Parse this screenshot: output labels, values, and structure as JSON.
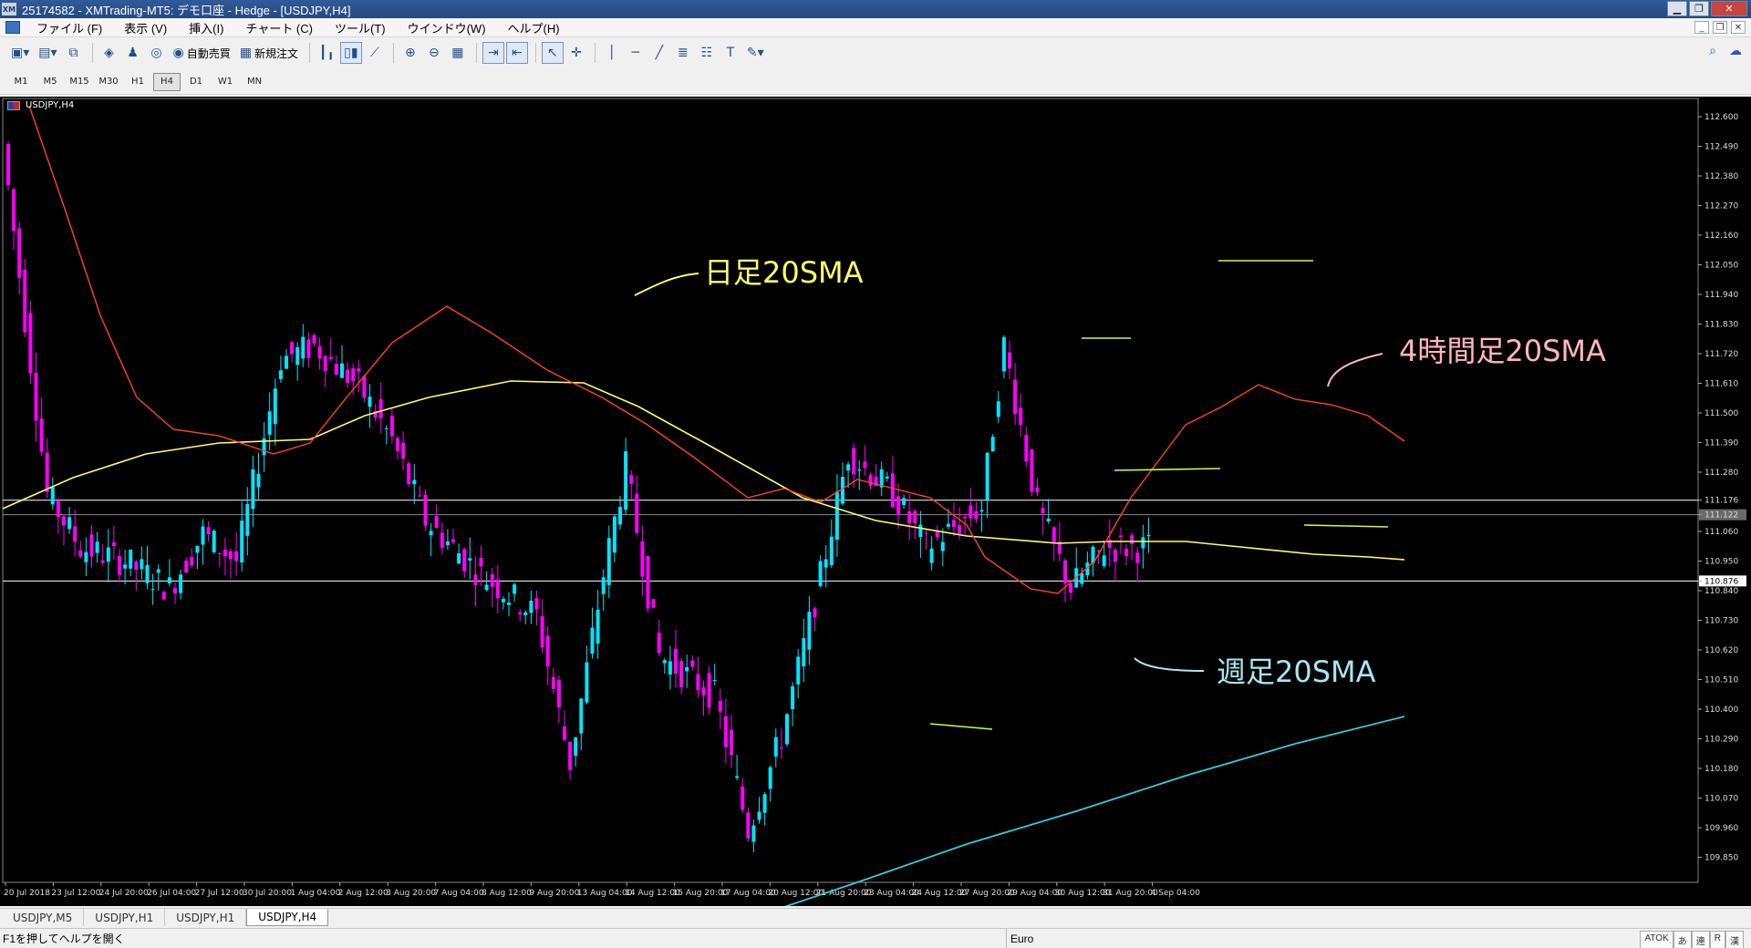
{
  "window": {
    "icon_text": "XM",
    "title": "25174582 - XMTrading-MT5: デモ口座 - Hedge - [USDJPY,H4]"
  },
  "menu": [
    {
      "label": "ファイル (F)"
    },
    {
      "label": "表示 (V)"
    },
    {
      "label": "挿入(I)"
    },
    {
      "label": "チャート (C)"
    },
    {
      "label": "ツール(T)"
    },
    {
      "label": "ウインドウ(W)"
    },
    {
      "label": "ヘルプ(H)"
    }
  ],
  "toolbar": {
    "auto_trade_label": "自動売買",
    "new_order_label": "新規注文"
  },
  "timeframes": [
    "M1",
    "M5",
    "M15",
    "M30",
    "H1",
    "H4",
    "D1",
    "W1",
    "MN"
  ],
  "active_timeframe": "H4",
  "chart": {
    "symbol_label": "USDJPY,H4",
    "price_labels": [
      "112.600",
      "112.490",
      "112.380",
      "112.270",
      "112.160",
      "112.050",
      "111.940",
      "111.830",
      "111.720",
      "111.610",
      "111.500",
      "111.390",
      "111.280",
      "111.176",
      "111.122",
      "111.060",
      "110.950",
      "110.876",
      "110.840",
      "110.730",
      "110.620",
      "110.510",
      "110.400",
      "110.290",
      "110.180",
      "110.070",
      "109.960",
      "109.850"
    ],
    "time_labels": [
      "20 Jul 2018",
      "23 Jul 12:00",
      "24 Jul 20:00",
      "26 Jul 04:00",
      "27 Jul 12:00",
      "30 Jul 20:00",
      "1 Aug 04:00",
      "2 Aug 12:00",
      "3 Aug 20:00",
      "7 Aug 04:00",
      "8 Aug 12:00",
      "9 Aug 20:00",
      "13 Aug 04:00",
      "14 Aug 12:00",
      "15 Aug 20:00",
      "17 Aug 04:00",
      "20 Aug 12:00",
      "21 Aug 20:00",
      "23 Aug 04:00",
      "24 Aug 12:00",
      "27 Aug 20:00",
      "29 Aug 04:00",
      "30 Aug 12:00",
      "31 Aug 20:00",
      "4 Sep 04:00"
    ],
    "annotations": {
      "daily_sma": "日足20SMA",
      "h4_sma": "4時間足20SMA",
      "weekly_sma": "週足20SMA"
    },
    "colors": {
      "background": "#000000",
      "bull": "#00e5ff",
      "bear": "#ff00ff",
      "daily_sma": "#ffff66",
      "h4_sma": "#ff4422",
      "weekly_sma": "#33ccdd",
      "level_line": "#ffffff",
      "marker": "#ccff33"
    }
  },
  "tabs": [
    "USDJPY,M5",
    "USDJPY,H1",
    "USDJPY,H1",
    "USDJPY,H4"
  ],
  "active_tab_index": 3,
  "status": {
    "help_text": "F1を押してヘルプを開く",
    "profile": "Euro",
    "ime": [
      "ATOK",
      "あ",
      "連",
      "R",
      "漢"
    ]
  }
}
